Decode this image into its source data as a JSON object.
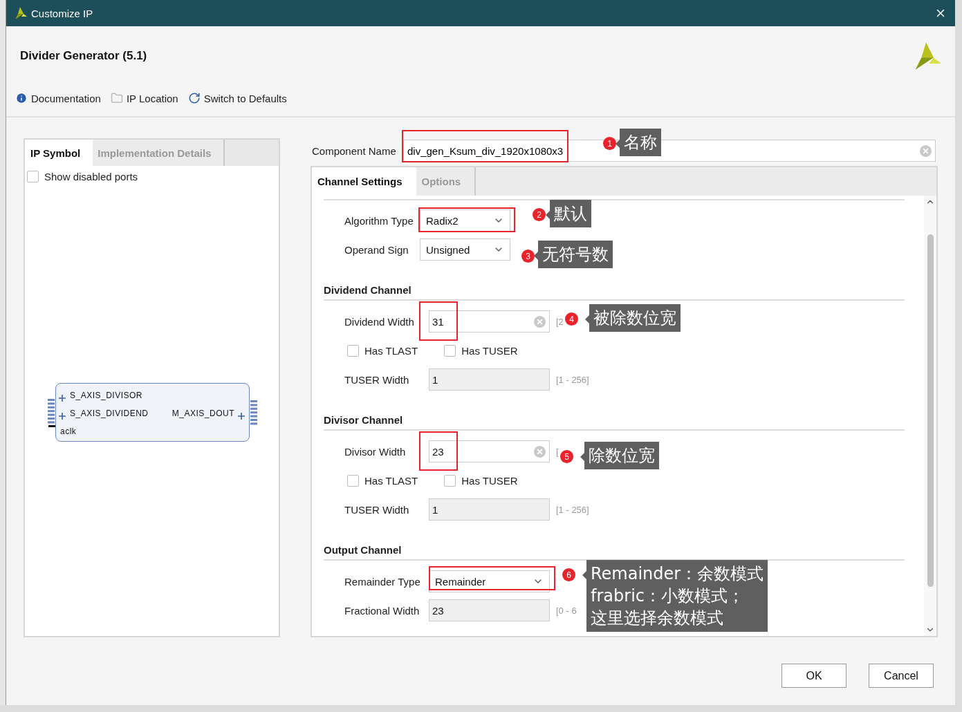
{
  "window": {
    "title": "Customize IP"
  },
  "header": {
    "title": "Divider Generator (5.1)"
  },
  "toolbar": [
    {
      "kind": "info",
      "label": "Documentation"
    },
    {
      "kind": "folder",
      "label": "IP Location"
    },
    {
      "kind": "refresh",
      "label": "Switch to Defaults"
    }
  ],
  "left_panel": {
    "tabs": [
      {
        "label": "IP Symbol",
        "selected": true
      },
      {
        "label": "Implementation Details",
        "selected": false
      }
    ],
    "show_disabled_ports": {
      "label": "Show disabled ports",
      "checked": false
    },
    "symbol": {
      "left_ports": [
        "S_AXIS_DIVISOR",
        "S_AXIS_DIVIDEND"
      ],
      "right_ports": [
        "M_AXIS_DOUT"
      ],
      "clock": "aclk"
    }
  },
  "component_name": {
    "label": "Component Name",
    "value": "div_gen_Ksum_div_1920x1080x3",
    "highlighted": true
  },
  "settings_tabs": [
    {
      "label": "Channel Settings",
      "selected": true
    },
    {
      "label": "Options",
      "selected": false
    }
  ],
  "sections": [
    {
      "rows": [
        {
          "kind": "select",
          "label": "Algorithm Type",
          "value": "Radix2",
          "highlighted": true
        },
        {
          "kind": "select",
          "label": "Operand Sign",
          "value": "Unsigned",
          "highlighted": false
        }
      ]
    },
    {
      "title": "Dividend Channel",
      "rows": [
        {
          "kind": "text",
          "label": "Dividend Width",
          "value": "31",
          "range": "[2",
          "highlighted": true
        },
        {
          "kind": "checkboxes",
          "items": [
            {
              "label": "Has TLAST",
              "checked": false
            },
            {
              "label": "Has TUSER",
              "checked": false
            }
          ]
        },
        {
          "kind": "readonly",
          "label": "TUSER Width",
          "value": "1",
          "range": "[1 - 256]"
        }
      ]
    },
    {
      "title": "Divisor Channel",
      "rows": [
        {
          "kind": "text",
          "label": "Divisor Width",
          "value": "23",
          "range": "[",
          "highlighted": true
        },
        {
          "kind": "checkboxes",
          "items": [
            {
              "label": "Has TLAST",
              "checked": false
            },
            {
              "label": "Has TUSER",
              "checked": false
            }
          ]
        },
        {
          "kind": "readonly",
          "label": "TUSER Width",
          "value": "1",
          "range": "[1 - 256]"
        }
      ]
    },
    {
      "title": "Output Channel",
      "rows": [
        {
          "kind": "select",
          "label": "Remainder Type",
          "value": "Remainder",
          "highlighted": true
        },
        {
          "kind": "readonly",
          "label": "Fractional Width",
          "value": "23",
          "range": "[0 - 6"
        }
      ]
    }
  ],
  "annotations": [
    {
      "number": "1",
      "lines": [
        "名称"
      ]
    },
    {
      "number": "2",
      "lines": [
        "默认"
      ]
    },
    {
      "number": "3",
      "lines": [
        "无符号数"
      ]
    },
    {
      "number": "4",
      "lines": [
        "被除数位宽"
      ]
    },
    {
      "number": "5",
      "lines": [
        "除数位宽"
      ]
    },
    {
      "number": "6",
      "lines": [
        "Remainder：余数模式",
        "frabric：小数模式；",
        "这里选择余数模式"
      ]
    }
  ],
  "buttons": [
    {
      "label": "OK"
    },
    {
      "label": "Cancel"
    }
  ]
}
